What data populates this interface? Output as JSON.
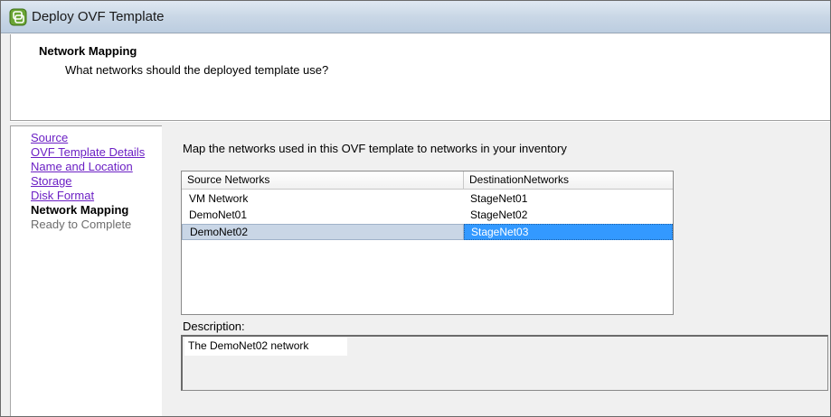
{
  "window": {
    "title": "Deploy OVF Template",
    "icon": "vsphere-app-icon"
  },
  "header": {
    "title": "Network Mapping",
    "subtitle": "What networks should the deployed template use?"
  },
  "nav": {
    "items": [
      {
        "label": "Source",
        "state": "link"
      },
      {
        "label": "OVF Template Details",
        "state": "link"
      },
      {
        "label": "Name and Location",
        "state": "link"
      },
      {
        "label": "Storage",
        "state": "link"
      },
      {
        "label": "Disk Format",
        "state": "link"
      },
      {
        "label": "Network Mapping",
        "state": "current"
      },
      {
        "label": "Ready to Complete",
        "state": "pending"
      }
    ]
  },
  "main": {
    "instructions": "Map the networks used in this OVF template to networks in your inventory",
    "table": {
      "columns": [
        "Source Networks",
        "DestinationNetworks"
      ],
      "rows": [
        {
          "source": "VM Network",
          "destination": "StageNet01",
          "selected": false
        },
        {
          "source": "DemoNet01",
          "destination": "StageNet02",
          "selected": false
        },
        {
          "source": "DemoNet02",
          "destination": "StageNet03",
          "selected": true
        }
      ]
    },
    "description_label": "Description:",
    "description_text": "The DemoNet02 network"
  },
  "colors": {
    "link": "#6b1fc4",
    "selection": "#3399ff",
    "row_selected": "#c9d6e6"
  }
}
